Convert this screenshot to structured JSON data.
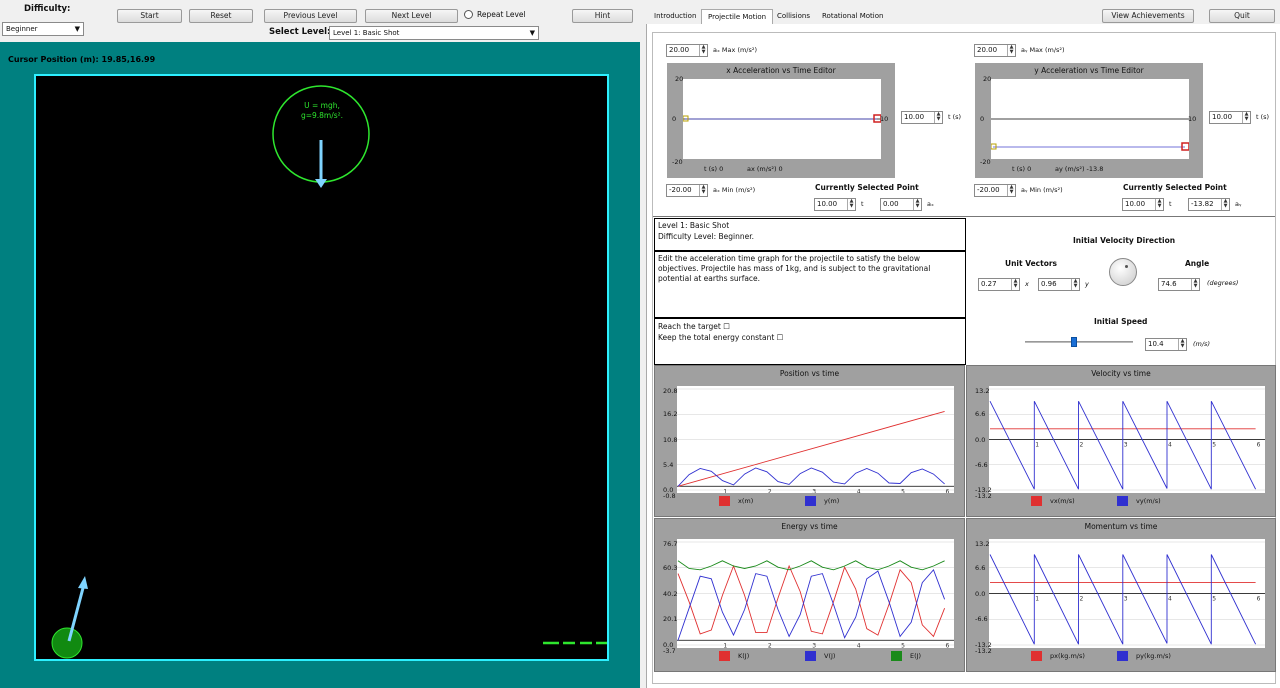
{
  "toolbar": {
    "difficulty_label": "Difficulty:",
    "difficulty_value": "Beginner",
    "start": "Start",
    "reset": "Reset",
    "previous_level": "Previous Level",
    "next_level": "Next Level",
    "repeat_level": "Repeat Level",
    "hint": "Hint",
    "select_level_label": "Select Level:",
    "select_level_value": "Level 1: Basic Shot"
  },
  "tabs": [
    "Introduction",
    "Projectile Motion",
    "Collisions",
    "Rotational Motion"
  ],
  "top_right": {
    "achievements": "View Achievements",
    "quit": "Quit"
  },
  "sim": {
    "cursor_position": "Cursor Position (m): 19.85,16.99",
    "potential_line1": "U = mgh,",
    "potential_line2": "g=9.8m/s²."
  },
  "x_editor": {
    "max_value": "20.00",
    "max_label": "aₓ Max (m/s²)",
    "title": "x Acceleration vs Time Editor",
    "y_top": "20",
    "y_mid": "0",
    "y_bot": "-20",
    "t_readout": "t (s) 0",
    "a_readout": "ax (m/s²) 0",
    "t_value": "10.00",
    "t_label": "t (s)",
    "right_tick": "10",
    "min_value": "-20.00",
    "min_label": "aₓ Min (m/s²)",
    "selected_label": "Currently Selected Point",
    "sel_t": "10.00",
    "sel_t_label": "t",
    "sel_a": "0.00",
    "sel_a_label": "aₓ"
  },
  "y_editor": {
    "max_value": "20.00",
    "max_label": "aᵧ Max (m/s²)",
    "title": "y Acceleration vs Time Editor",
    "y_top": "20",
    "y_mid": "0",
    "y_bot": "-20",
    "t_readout": "t (s) 0",
    "a_readout": "ay (m/s²) -13.8",
    "t_value": "10.00",
    "t_label": "t (s)",
    "right_tick": "10",
    "min_value": "-20.00",
    "min_label": "aᵧ Min (m/s²)",
    "selected_label": "Currently Selected Point",
    "sel_t": "10.00",
    "sel_t_label": "t",
    "sel_a": "-13.82",
    "sel_a_label": "aᵧ"
  },
  "info": {
    "level_name": "Level 1: Basic Shot",
    "difficulty": "Difficulty Level: Beginner.",
    "description": "Edit the acceleration time graph for the projectile to satisfy the below objectives. Projectile has mass of 1kg, and is subject to the gravitational potential at earths surface.",
    "objective1": "Reach the target ☐",
    "objective2": "Keep the total energy constant ☐"
  },
  "velocity_panel": {
    "title": "Initial Velocity Direction",
    "unit_vectors": "Unit Vectors",
    "ux": "0.27",
    "ux_label": "x",
    "uy": "0.96",
    "uy_label": "y",
    "angle_label": "Angle",
    "angle_value": "74.6",
    "angle_unit": "(degrees)",
    "speed_title": "Initial Speed",
    "speed_value": "10.4",
    "speed_unit": "(m/s)",
    "speed_fraction": 0.45
  },
  "chart_data": [
    {
      "type": "line",
      "title": "Position vs time",
      "yticks": [
        "20.8",
        "16.2",
        "10.8",
        "5.4",
        "0.0",
        "-0.8"
      ],
      "xticks": [
        "1",
        "2",
        "3",
        "4",
        "5",
        "6"
      ],
      "ylim": [
        -0.8,
        20.8
      ],
      "xlim": [
        0,
        6.1
      ],
      "series": [
        {
          "name": "x(m)",
          "color": "#e03030",
          "x": [
            0,
            6
          ],
          "y": [
            0,
            16.0
          ]
        },
        {
          "name": "y(m)",
          "color": "#3030d0",
          "x": [
            0,
            0.25,
            0.5,
            0.75,
            1,
            1.25,
            1.5,
            1.75,
            2,
            2.25,
            2.5,
            2.75,
            3,
            3.25,
            3.5,
            3.75,
            4,
            4.25,
            4.5,
            4.75,
            5,
            5.25,
            5.5,
            5.75,
            6
          ],
          "y": [
            0,
            2.5,
            3.8,
            3.2,
            1.2,
            0.3,
            2.6,
            3.9,
            3.1,
            1.0,
            0.4,
            2.7,
            3.9,
            3.0,
            0.9,
            0.5,
            2.8,
            3.8,
            2.8,
            0.7,
            0.6,
            2.9,
            3.7,
            2.6,
            0.5
          ]
        }
      ]
    },
    {
      "type": "line",
      "title": "Velocity vs time",
      "yticks": [
        "13.2",
        "6.6",
        "0.0",
        "-6.6",
        "-13.2",
        "-13.2"
      ],
      "xticks": [
        "1",
        "2",
        "3",
        "4",
        "5",
        "6"
      ],
      "ylim": [
        -13.2,
        13.2
      ],
      "xlim": [
        0,
        6.1
      ],
      "series": [
        {
          "name": "vx(m/s)",
          "color": "#e03030",
          "x": [
            0,
            6
          ],
          "y": [
            2.8,
            2.8
          ]
        },
        {
          "name": "vy(m/s)",
          "color": "#3030d0",
          "x": [
            0,
            1.0,
            1.0,
            2.0,
            2.0,
            3.0,
            3.0,
            4.0,
            4.0,
            5.0,
            5.0,
            6.0
          ],
          "y": [
            10.0,
            -13.0,
            10.0,
            -13.0,
            10.0,
            -13.0,
            10.0,
            -12.8,
            10.0,
            -13.0,
            10.0,
            -13.0
          ]
        }
      ]
    },
    {
      "type": "line",
      "title": "Energy vs time",
      "yticks": [
        "76.7",
        "60.3",
        "40.2",
        "20.1",
        "0.0",
        "-3.7"
      ],
      "xticks": [
        "1",
        "2",
        "3",
        "4",
        "5",
        "6"
      ],
      "ylim": [
        -3.7,
        76.7
      ],
      "xlim": [
        0,
        6.1
      ],
      "series": [
        {
          "name": "K(J)",
          "color": "#e03030",
          "x": [
            0,
            0.25,
            0.5,
            0.75,
            1,
            1.25,
            1.5,
            1.75,
            2,
            2.25,
            2.5,
            2.75,
            3,
            3.25,
            3.5,
            3.75,
            4,
            4.25,
            4.5,
            4.75,
            5,
            5.25,
            5.5,
            5.75,
            6
          ],
          "y": [
            52,
            30,
            5,
            8,
            35,
            58,
            35,
            6,
            6,
            33,
            58,
            38,
            7,
            5,
            30,
            57,
            40,
            9,
            4,
            28,
            55,
            45,
            12,
            3,
            25
          ]
        },
        {
          "name": "V(J)",
          "color": "#3030d0",
          "x": [
            0,
            0.25,
            0.5,
            0.75,
            1,
            1.25,
            1.5,
            1.75,
            2,
            2.25,
            2.5,
            2.75,
            3,
            3.25,
            3.5,
            3.75,
            4,
            4.25,
            4.5,
            4.75,
            5,
            5.25,
            5.5,
            5.75,
            6
          ],
          "y": [
            0,
            25,
            50,
            48,
            22,
            4,
            24,
            52,
            50,
            24,
            3,
            20,
            50,
            52,
            28,
            2,
            18,
            48,
            54,
            30,
            3,
            14,
            45,
            55,
            32
          ]
        },
        {
          "name": "E(J)",
          "color": "#1a8a1a",
          "x": [
            0,
            0.25,
            0.5,
            0.75,
            1,
            1.25,
            1.5,
            1.75,
            2,
            2.25,
            2.5,
            2.75,
            3,
            3.25,
            3.5,
            3.75,
            4,
            4.25,
            4.5,
            4.75,
            5,
            5.25,
            5.5,
            5.75,
            6
          ],
          "y": [
            62,
            56,
            55,
            58,
            62,
            58,
            56,
            58,
            62,
            57,
            55,
            58,
            62,
            57,
            55,
            58,
            62,
            57,
            55,
            58,
            62,
            57,
            55,
            58,
            62
          ]
        }
      ]
    },
    {
      "type": "line",
      "title": "Momentum vs time",
      "yticks": [
        "13.2",
        "6.6",
        "0.0",
        "-6.6",
        "-13.2",
        "-13.2"
      ],
      "xticks": [
        "1",
        "2",
        "3",
        "4",
        "5",
        "6"
      ],
      "ylim": [
        -13.2,
        13.2
      ],
      "xlim": [
        0,
        6.1
      ],
      "series": [
        {
          "name": "px(kg.m/s)",
          "color": "#e03030",
          "x": [
            0,
            6
          ],
          "y": [
            2.8,
            2.8
          ]
        },
        {
          "name": "py(kg.m/s)",
          "color": "#3030d0",
          "x": [
            0,
            1.0,
            1.0,
            2.0,
            2.0,
            3.0,
            3.0,
            4.0,
            4.0,
            5.0,
            5.0,
            6.0
          ],
          "y": [
            10.0,
            -13.0,
            10.0,
            -13.0,
            10.0,
            -13.0,
            10.0,
            -12.8,
            10.0,
            -13.0,
            10.0,
            -13.0
          ]
        }
      ]
    }
  ]
}
